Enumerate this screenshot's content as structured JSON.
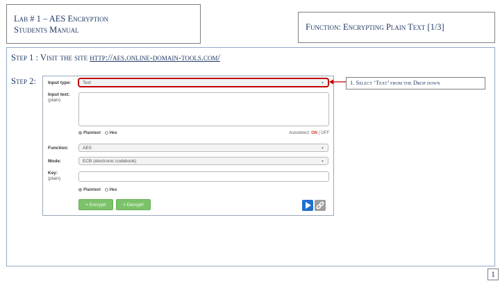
{
  "header_left": {
    "line1": "Lab # 1 – AES Encryption",
    "line2": "Students Manual"
  },
  "header_right": {
    "title": "Function: Encrypting Plain Text [1/3]"
  },
  "step1": {
    "label": "Step 1 : Visit the site ",
    "link": "http://aes.online-domain-tools.com/"
  },
  "step2": {
    "label": "Step 2:"
  },
  "tool": {
    "input_type_label": "Input type:",
    "input_type_value": "Text",
    "input_text_label": "Input text:",
    "input_text_sub": "(plain)",
    "format_plaintext": "Plaintext",
    "format_hex": "Hex",
    "autodetect_label": "Autodetect:",
    "autodetect_on": "ON",
    "autodetect_sep": "|",
    "autodetect_off": "OFF",
    "function_label": "Function:",
    "function_value": "AES",
    "mode_label": "Mode:",
    "mode_value": "ECB (electronic codebook)",
    "key_label": "Key:",
    "key_sub": "(plain)",
    "key_format_plaintext": "Plaintext",
    "key_format_hex": "Hex",
    "encrypt_button": "> Encrypt!",
    "decrypt_button": "> Decrypt!"
  },
  "callout": {
    "text": "1. Select ‘Text’ from the Drop down"
  },
  "page_number": "1",
  "colors": {
    "highlight": "#c00000",
    "autodetect_on": "#d9302c",
    "button_green": "#7cc36a",
    "play_blue": "#1f6fd0"
  }
}
